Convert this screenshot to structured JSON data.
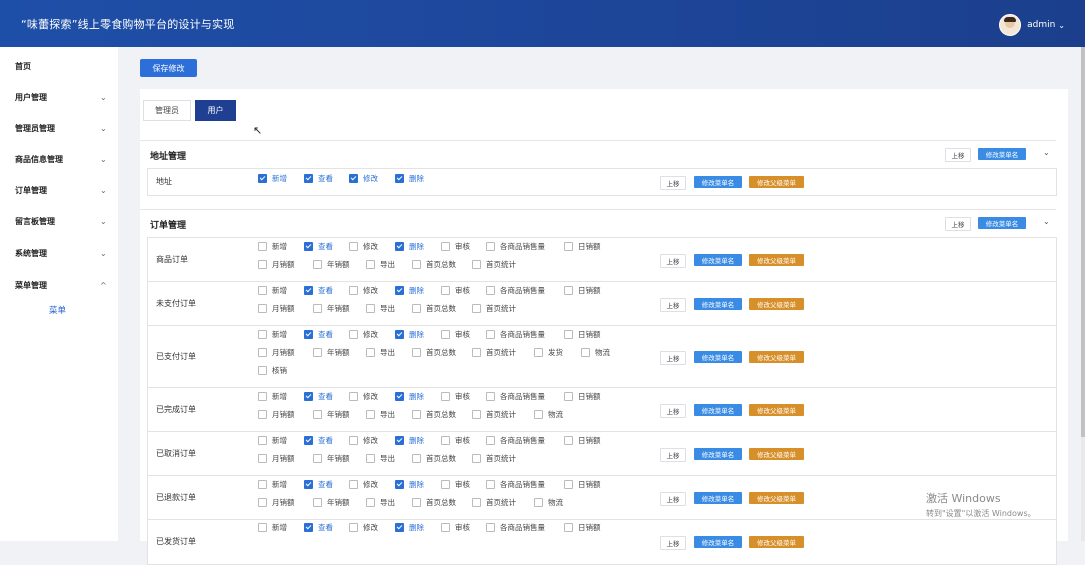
{
  "app_title": "“味蕾探索”线上零食购物平台的设计与实现",
  "user": {
    "name": "admin",
    "caret": "⌄"
  },
  "sidebar": {
    "items": [
      {
        "label": "首页",
        "chevron": ""
      },
      {
        "label": "用户管理",
        "chevron": "⌄"
      },
      {
        "label": "管理员管理",
        "chevron": "⌄"
      },
      {
        "label": "商品信息管理",
        "chevron": "⌄"
      },
      {
        "label": "订单管理",
        "chevron": "⌄"
      },
      {
        "label": "留言板管理",
        "chevron": "⌄"
      },
      {
        "label": "系统管理",
        "chevron": "⌄"
      },
      {
        "label": "菜单管理",
        "chevron": "^"
      }
    ],
    "sub_item": "菜单"
  },
  "toolbar": {
    "save_label": "保存修改"
  },
  "tabs": [
    {
      "label": "管理员",
      "active": false
    },
    {
      "label": "用户",
      "active": true
    }
  ],
  "labels": {
    "move_up": "上移",
    "rename": "修改菜单名",
    "rename_parent": "修改父级菜单"
  },
  "sections": [
    {
      "title": "地址管理",
      "rows": [
        {
          "label": "地址",
          "options": [
            {
              "text": "新增",
              "checked": true
            },
            {
              "text": "查看",
              "checked": true
            },
            {
              "text": "修改",
              "checked": true
            },
            {
              "text": "删除",
              "checked": true
            }
          ]
        }
      ]
    },
    {
      "title": "订单管理",
      "rows": [
        {
          "label": "商品订单",
          "options": [
            {
              "text": "新增",
              "checked": false
            },
            {
              "text": "查看",
              "checked": true
            },
            {
              "text": "修改",
              "checked": false
            },
            {
              "text": "删除",
              "checked": true
            },
            {
              "text": "审核",
              "checked": false
            },
            {
              "text": "各商品销售量",
              "checked": false
            },
            {
              "text": "日销额",
              "checked": false
            },
            {
              "text": "月销额",
              "checked": false
            },
            {
              "text": "年销额",
              "checked": false
            },
            {
              "text": "导出",
              "checked": false
            },
            {
              "text": "首页总数",
              "checked": false
            },
            {
              "text": "首页统计",
              "checked": false
            }
          ]
        },
        {
          "label": "未支付订单",
          "options": [
            {
              "text": "新增",
              "checked": false
            },
            {
              "text": "查看",
              "checked": true
            },
            {
              "text": "修改",
              "checked": false
            },
            {
              "text": "删除",
              "checked": true
            },
            {
              "text": "审核",
              "checked": false
            },
            {
              "text": "各商品销售量",
              "checked": false
            },
            {
              "text": "日销额",
              "checked": false
            },
            {
              "text": "月销额",
              "checked": false
            },
            {
              "text": "年销额",
              "checked": false
            },
            {
              "text": "导出",
              "checked": false
            },
            {
              "text": "首页总数",
              "checked": false
            },
            {
              "text": "首页统计",
              "checked": false
            }
          ]
        },
        {
          "label": "已支付订单",
          "options": [
            {
              "text": "新增",
              "checked": false
            },
            {
              "text": "查看",
              "checked": true
            },
            {
              "text": "修改",
              "checked": false
            },
            {
              "text": "删除",
              "checked": true
            },
            {
              "text": "审核",
              "checked": false
            },
            {
              "text": "各商品销售量",
              "checked": false
            },
            {
              "text": "日销额",
              "checked": false
            },
            {
              "text": "月销额",
              "checked": false
            },
            {
              "text": "年销额",
              "checked": false
            },
            {
              "text": "导出",
              "checked": false
            },
            {
              "text": "首页总数",
              "checked": false
            },
            {
              "text": "首页统计",
              "checked": false
            },
            {
              "text": "发货",
              "checked": false
            },
            {
              "text": "物流",
              "checked": false
            },
            {
              "text": "核销",
              "checked": false
            }
          ]
        },
        {
          "label": "已完成订单",
          "options": [
            {
              "text": "新增",
              "checked": false
            },
            {
              "text": "查看",
              "checked": true
            },
            {
              "text": "修改",
              "checked": false
            },
            {
              "text": "删除",
              "checked": true
            },
            {
              "text": "审核",
              "checked": false
            },
            {
              "text": "各商品销售量",
              "checked": false
            },
            {
              "text": "日销额",
              "checked": false
            },
            {
              "text": "月销额",
              "checked": false
            },
            {
              "text": "年销额",
              "checked": false
            },
            {
              "text": "导出",
              "checked": false
            },
            {
              "text": "首页总数",
              "checked": false
            },
            {
              "text": "首页统计",
              "checked": false
            },
            {
              "text": "物流",
              "checked": false
            }
          ]
        },
        {
          "label": "已取消订单",
          "options": [
            {
              "text": "新增",
              "checked": false
            },
            {
              "text": "查看",
              "checked": true
            },
            {
              "text": "修改",
              "checked": false
            },
            {
              "text": "删除",
              "checked": true
            },
            {
              "text": "审核",
              "checked": false
            },
            {
              "text": "各商品销售量",
              "checked": false
            },
            {
              "text": "日销额",
              "checked": false
            },
            {
              "text": "月销额",
              "checked": false
            },
            {
              "text": "年销额",
              "checked": false
            },
            {
              "text": "导出",
              "checked": false
            },
            {
              "text": "首页总数",
              "checked": false
            },
            {
              "text": "首页统计",
              "checked": false
            }
          ]
        },
        {
          "label": "已退款订单",
          "options": [
            {
              "text": "新增",
              "checked": false
            },
            {
              "text": "查看",
              "checked": true
            },
            {
              "text": "修改",
              "checked": false
            },
            {
              "text": "删除",
              "checked": true
            },
            {
              "text": "审核",
              "checked": false
            },
            {
              "text": "各商品销售量",
              "checked": false
            },
            {
              "text": "日销额",
              "checked": false
            },
            {
              "text": "月销额",
              "checked": false
            },
            {
              "text": "年销额",
              "checked": false
            },
            {
              "text": "导出",
              "checked": false
            },
            {
              "text": "首页总数",
              "checked": false
            },
            {
              "text": "首页统计",
              "checked": false
            },
            {
              "text": "物流",
              "checked": false
            }
          ]
        },
        {
          "label": "已发货订单",
          "options": [
            {
              "text": "新增",
              "checked": false
            },
            {
              "text": "查看",
              "checked": true
            },
            {
              "text": "修改",
              "checked": false
            },
            {
              "text": "删除",
              "checked": true
            },
            {
              "text": "审核",
              "checked": false
            },
            {
              "text": "各商品销售量",
              "checked": false
            },
            {
              "text": "日销额",
              "checked": false
            }
          ]
        }
      ]
    }
  ],
  "watermark": {
    "line1": "激活 Windows",
    "line2": "转到\"设置\"以激活 Windows。"
  }
}
